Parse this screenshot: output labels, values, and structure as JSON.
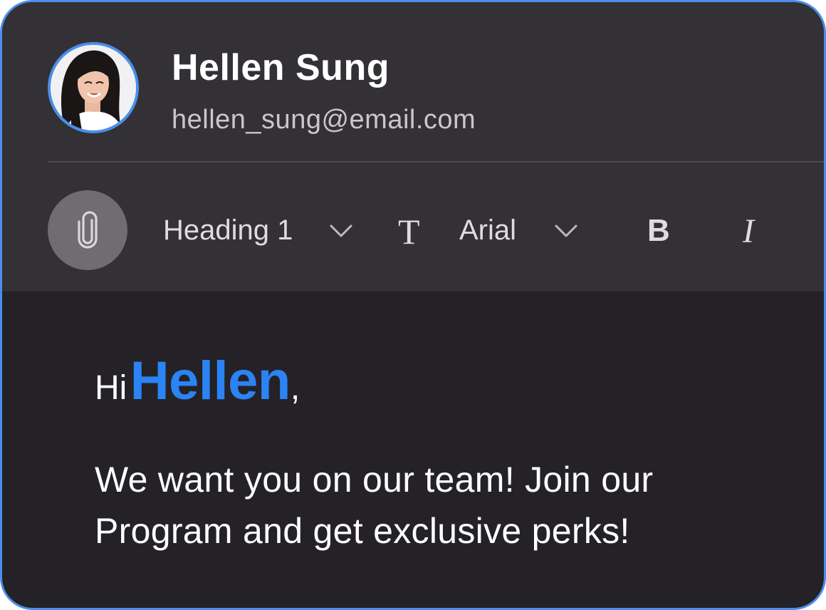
{
  "sender": {
    "name": "Hellen Sung",
    "email": "hellen_sung@email.com"
  },
  "toolbar": {
    "attach_icon": "paperclip-icon",
    "heading_style": "Heading 1",
    "text_icon": "T",
    "font": "Arial",
    "bold_label": "B",
    "italic_label": "I"
  },
  "body": {
    "greeting": "Hi",
    "greeting_name": "Hellen",
    "greeting_punct": ",",
    "message": "We want you on our team! Join our Program and get exclusive perks!"
  },
  "colors": {
    "accent": "#2b83f6",
    "border": "#4a8eea",
    "header_bg": "#333135",
    "body_bg": "#242226"
  }
}
